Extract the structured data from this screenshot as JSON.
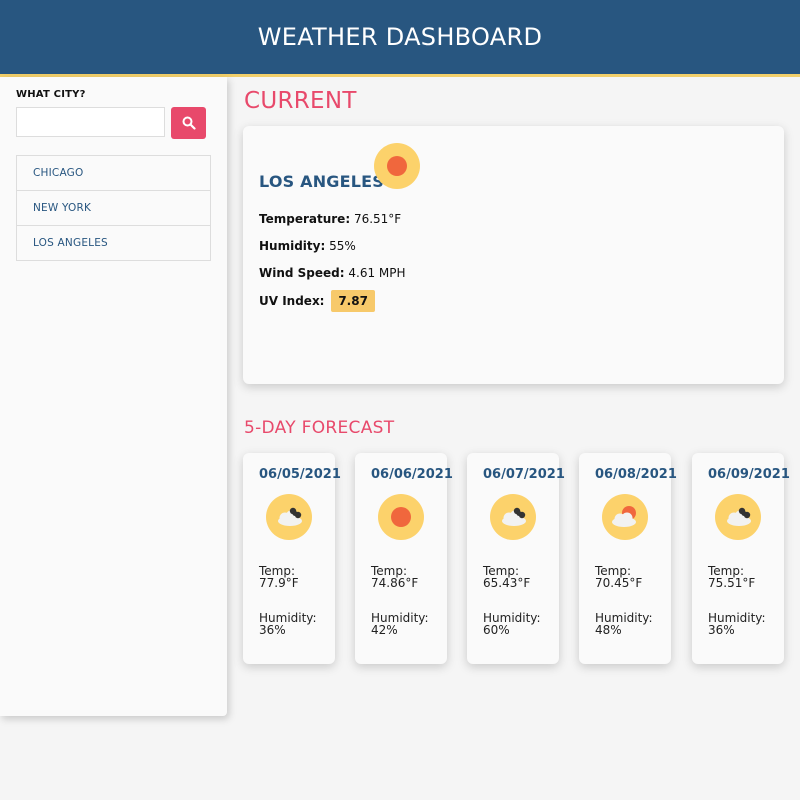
{
  "header": {
    "title": "WEATHER DASHBOARD"
  },
  "sidebar": {
    "label": "WHAT CITY?",
    "search": {
      "value": "",
      "placeholder": ""
    },
    "cities": [
      "CHICAGO",
      "NEW YORK",
      "LOS ANGELES"
    ]
  },
  "current": {
    "section_title": "CURRENT",
    "city": "LOS ANGELES",
    "icon": "sun-icon",
    "temperature_label": "Temperature:",
    "temperature": "76.51°F",
    "humidity_label": "Humidity:",
    "humidity": "55%",
    "wind_label": "Wind Speed:",
    "wind": "4.61 MPH",
    "uv_label": "UV Index:",
    "uv": "7.87"
  },
  "forecast": {
    "section_title": "5-DAY FORECAST",
    "temp_label": "Temp:",
    "humidity_label": "Humidity:",
    "days": [
      {
        "date": "06/05/2021",
        "icon": "cloud-rain-icon",
        "temp": "77.9°F",
        "humidity": "36%"
      },
      {
        "date": "06/06/2021",
        "icon": "sun-icon",
        "temp": "74.86°F",
        "humidity": "42%"
      },
      {
        "date": "06/07/2021",
        "icon": "cloud-rain-icon",
        "temp": "65.43°F",
        "humidity": "60%"
      },
      {
        "date": "06/08/2021",
        "icon": "partly-cloudy-icon",
        "temp": "70.45°F",
        "humidity": "48%"
      },
      {
        "date": "06/09/2021",
        "icon": "cloud-rain-icon",
        "temp": "75.51°F",
        "humidity": "36%"
      }
    ]
  },
  "colors": {
    "header_bg": "#285680",
    "accent": "#e8496b",
    "city_text": "#285680",
    "uv_badge": "#f7c96a",
    "icon_circle": "#fcd26b",
    "sun_core": "#f0673d"
  }
}
